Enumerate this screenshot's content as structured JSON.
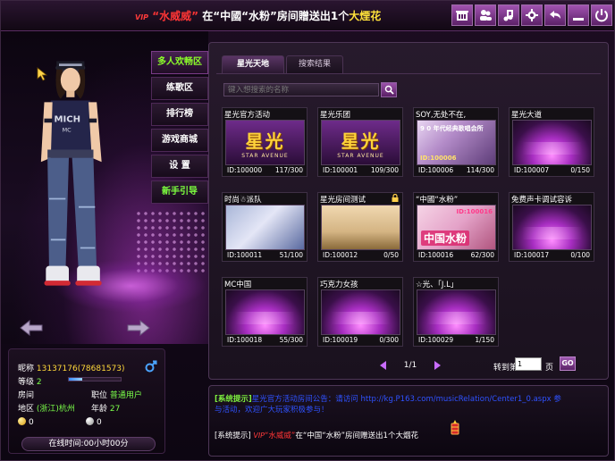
{
  "topbar": {
    "marquee": {
      "vip": "VIP",
      "q_open": "“",
      "user": "水威威",
      "q_close": "”",
      "at": "在",
      "room_open": "“中國“",
      "room_name": "水粉",
      "room_close": "”房间贈送出1个",
      "gift": "大煙花"
    },
    "tools": [
      "shop-icon",
      "users-icon",
      "music-icon",
      "gear-icon",
      "back-icon",
      "minimize-icon",
      "power-icon"
    ]
  },
  "menu": {
    "items": [
      {
        "label": "多人欢畅区"
      },
      {
        "label": "练歌区"
      },
      {
        "label": "排行榜"
      },
      {
        "label": "游戏商城"
      },
      {
        "label": "设  置"
      },
      {
        "label": "新手引导"
      }
    ]
  },
  "profile": {
    "nick_label": "昵称",
    "nick_value": "13137176(78681573)",
    "level_label": "等级",
    "level_value": "2",
    "level_progress": 0.25,
    "room_label": "房间",
    "job_label": "职位",
    "job_value": "普通用户",
    "region_label": "地区",
    "region_value": "(浙江)杭州",
    "age_label": "年龄",
    "age_value": "27",
    "gold": "0",
    "silver": "0",
    "online_time": "在线时间:00小时00分"
  },
  "room_panel": {
    "tab_active": "星光天地",
    "tab_search": "搜索结果",
    "search_placeholder": "键入想搜索的名称",
    "rooms": [
      {
        "title": "星光官方活动",
        "id": "ID:100000",
        "count": "117/300"
      },
      {
        "title": "星光乐团",
        "id": "ID:100001",
        "count": "109/300"
      },
      {
        "title": "SOY,无处不在,",
        "id": "ID:100006",
        "count": "114/300"
      },
      {
        "title": "星光大道",
        "id": "ID:100007",
        "count": "0/150"
      },
      {
        "title": "时尚☃派队",
        "id": "ID:100011",
        "count": "51/100"
      },
      {
        "title": "星光房间测试",
        "id": "ID:100012",
        "count": "0/50"
      },
      {
        "title": "“中國“水粉”",
        "id": "ID:100016",
        "count": "62/300"
      },
      {
        "title": "免费声卡调试容诉",
        "id": "ID:100017",
        "count": "0/100"
      },
      {
        "title": "MC中国",
        "id": "ID:100018",
        "count": "55/300"
      },
      {
        "title": "巧克力女孩",
        "id": "ID:100019",
        "count": "0/300"
      },
      {
        "title": "☆光、「J.L」",
        "id": "ID:100029",
        "count": "1/150"
      }
    ],
    "thumb_texts": {
      "logo_big": "星光",
      "logo_small": "STAR AVENUE",
      "soy_caption": "9 0 年代经典歌唱会所",
      "soy_id": "ID:100006",
      "fans_mark": "中国水粉",
      "fans_id": "ID:100016"
    },
    "pager": {
      "page": "1/1",
      "goto_label": "转到第",
      "goto_value": "1",
      "unit": "页",
      "go": "GO"
    }
  },
  "system": {
    "line1_tag": "[系统提示]",
    "line1_text": "星光官方活动房间公告：请访问 http://kg.P163.com/musicRelation/Center1_0.aspx 参",
    "line2_text": "与活动，欢迎广大玩家积极参与！",
    "line3_tag": "[系统提示]",
    "line3_vip": "VIP",
    "line3_q_open": "“",
    "line3_user": "水威威",
    "line3_q_close": "”",
    "line3_rest": "在“中国“水粉”房间赠送出1个大烟花"
  }
}
